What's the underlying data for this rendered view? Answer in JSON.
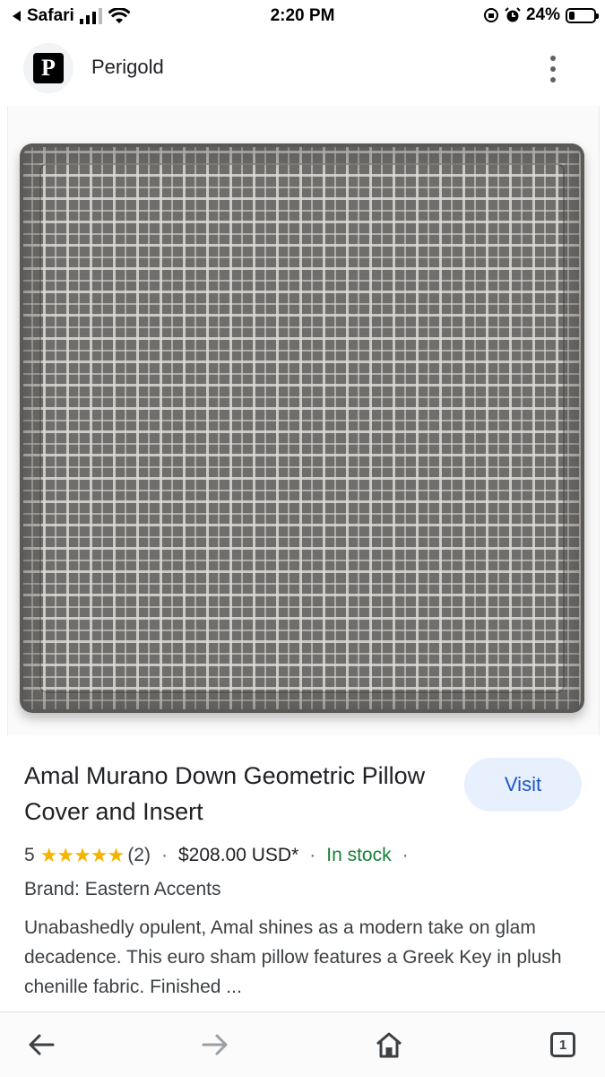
{
  "status_bar": {
    "back_app": "Safari",
    "time": "2:20 PM",
    "battery": "24%",
    "battery_level": 0.24
  },
  "header": {
    "logo_letter": "P",
    "site_name": "Perigold"
  },
  "product": {
    "title": "Amal Murano Down Geometric Pillow Cover and Insert",
    "visit_label": "Visit",
    "rating": "5",
    "stars": "★★★★★",
    "review_count": "(2)",
    "price": "$208.00 USD*",
    "availability": "In stock",
    "separator": "·",
    "brand": "Brand: Eastern Accents",
    "description": "Unabashedly opulent, Amal shines as a modern take on glam decadence. This euro sham pillow features a Greek Key in plush chenille fabric. Finished ..."
  },
  "bottom_bar": {
    "tab_count": "1"
  },
  "colors": {
    "accent": "#1a56c9",
    "visit_bg": "#e8f0fe",
    "star": "#f4b400",
    "in_stock": "#188038"
  },
  "icons": [
    "signal-icon",
    "wifi-icon",
    "orientation-lock-icon",
    "alarm-icon",
    "battery-icon",
    "more-vert-icon",
    "back-arrow-icon",
    "forward-arrow-icon",
    "home-icon",
    "tabs-icon"
  ]
}
